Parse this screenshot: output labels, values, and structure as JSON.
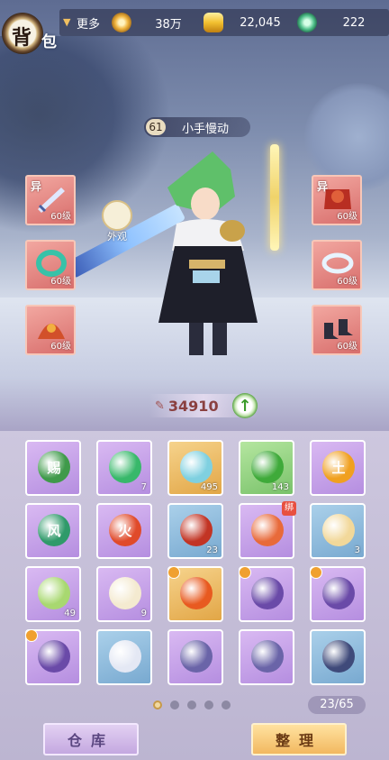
{
  "header": {
    "title_chars": [
      "背",
      "包"
    ],
    "more_label": "更多"
  },
  "currencies": [
    {
      "icon": "coin-icon",
      "value": "38万",
      "color": "#f0b540"
    },
    {
      "icon": "gold-ingot-icon",
      "value": "22,045",
      "color": "#f2c030"
    },
    {
      "icon": "jade-icon",
      "value": "222",
      "color": "#4fbf8a"
    }
  ],
  "character": {
    "level": "61",
    "name": "小手慢动",
    "power": "34910",
    "outfit_label": "外观"
  },
  "equipment": {
    "left": [
      {
        "icon": "sword-icon",
        "level": "60级",
        "tag": "异"
      },
      {
        "icon": "bracelet-icon",
        "level": "60级",
        "tag": ""
      },
      {
        "icon": "helmet-icon",
        "level": "60级",
        "tag": ""
      }
    ],
    "right": [
      {
        "icon": "armor-icon",
        "level": "60级",
        "tag": "异"
      },
      {
        "icon": "ring-icon",
        "level": "60级",
        "tag": ""
      },
      {
        "icon": "boots-icon",
        "level": "60级",
        "tag": ""
      }
    ]
  },
  "inventory": [
    {
      "icon": "gift-scroll-icon",
      "count": "",
      "rarity": "purple",
      "glyph": "赐"
    },
    {
      "icon": "green-orb-icon",
      "count": "7",
      "rarity": "purple",
      "glyph": ""
    },
    {
      "icon": "potion-icon",
      "count": "495",
      "rarity": "gold",
      "glyph": ""
    },
    {
      "icon": "green-pearl-icon",
      "count": "143",
      "rarity": "green",
      "glyph": ""
    },
    {
      "icon": "earth-orb-icon",
      "count": "",
      "rarity": "purple",
      "glyph": "土"
    },
    {
      "icon": "wind-orb-icon",
      "count": "",
      "rarity": "purple",
      "glyph": "风"
    },
    {
      "icon": "fire-orb-icon",
      "count": "",
      "rarity": "purple",
      "glyph": "火"
    },
    {
      "icon": "red-card-icon",
      "count": "23",
      "rarity": "blue",
      "glyph": ""
    },
    {
      "icon": "noodle-bowl-icon",
      "count": "",
      "rarity": "purple",
      "glyph": "",
      "tag": "绑"
    },
    {
      "icon": "dumpling-icon",
      "count": "3",
      "rarity": "blue",
      "glyph": ""
    },
    {
      "icon": "green-gourd-icon",
      "count": "49",
      "rarity": "purple",
      "glyph": ""
    },
    {
      "icon": "white-gourd-icon",
      "count": "9",
      "rarity": "purple",
      "glyph": ""
    },
    {
      "icon": "fire-pouch-icon",
      "count": "",
      "rarity": "gold",
      "glyph": "",
      "badge": true
    },
    {
      "icon": "purple-pouch-icon",
      "count": "",
      "rarity": "purple",
      "glyph": "",
      "badge": true
    },
    {
      "icon": "purple-pouch-icon",
      "count": "",
      "rarity": "purple",
      "glyph": "",
      "badge": true
    },
    {
      "icon": "purple-pouch-icon",
      "count": "",
      "rarity": "purple",
      "glyph": "",
      "badge": true
    },
    {
      "icon": "necklace-icon",
      "count": "",
      "rarity": "blue",
      "glyph": ""
    },
    {
      "icon": "chest-armor-icon",
      "count": "",
      "rarity": "purple",
      "glyph": ""
    },
    {
      "icon": "chest-armor-icon",
      "count": "",
      "rarity": "purple",
      "glyph": ""
    },
    {
      "icon": "jar-icon",
      "count": "",
      "rarity": "blue",
      "glyph": ""
    }
  ],
  "pager": {
    "pages": 5,
    "current": 0,
    "count_text": "23/65"
  },
  "buttons": {
    "store": "仓库",
    "sort": "整理"
  }
}
